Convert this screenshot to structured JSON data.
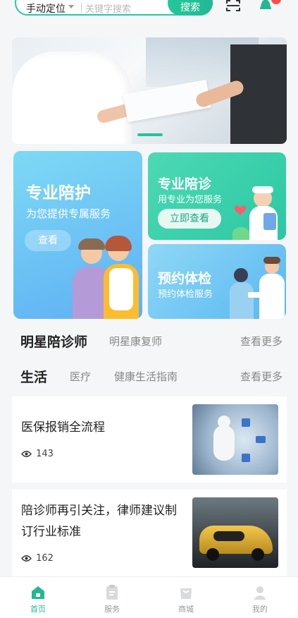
{
  "search": {
    "location": "手动定位",
    "placeholder": "关键字搜索",
    "button": "搜索"
  },
  "banner": {
    "slides": 3,
    "active_slide": 2
  },
  "services": {
    "big": {
      "title": "专业陪护",
      "subtitle": "为您提供专属服务",
      "button": "查看"
    },
    "top_right": {
      "title": "专业陪诊",
      "subtitle": "用专业为您服务",
      "button": "立即查看"
    },
    "bottom_right": {
      "title": "预约体检",
      "subtitle": "预约体检服务"
    }
  },
  "star_section": {
    "tabs": [
      "明星陪诊师",
      "明星康复师"
    ],
    "more": "查看更多"
  },
  "life_section": {
    "tabs": [
      "生活",
      "医疗",
      "健康生活指南"
    ],
    "more": "查看更多"
  },
  "articles": [
    {
      "title": "医保报销全流程",
      "views": "143",
      "image": "robot-medical-tech"
    },
    {
      "title_line1": "陪诊师再引关注，律师建议制",
      "title_line2": "订行业标准",
      "views": "162",
      "image": "sports-car"
    }
  ],
  "bottom_nav": [
    {
      "label": "首页",
      "icon": "home-icon",
      "active": true
    },
    {
      "label": "服务",
      "icon": "service-icon",
      "active": false
    },
    {
      "label": "商城",
      "icon": "shop-icon",
      "active": false
    },
    {
      "label": "我的",
      "icon": "profile-icon",
      "active": false
    }
  ],
  "colors": {
    "accent": "#22b893",
    "badge": "#ff4b4b",
    "card_blue": "#5fb0f3",
    "card_green": "#2bc8a3"
  }
}
